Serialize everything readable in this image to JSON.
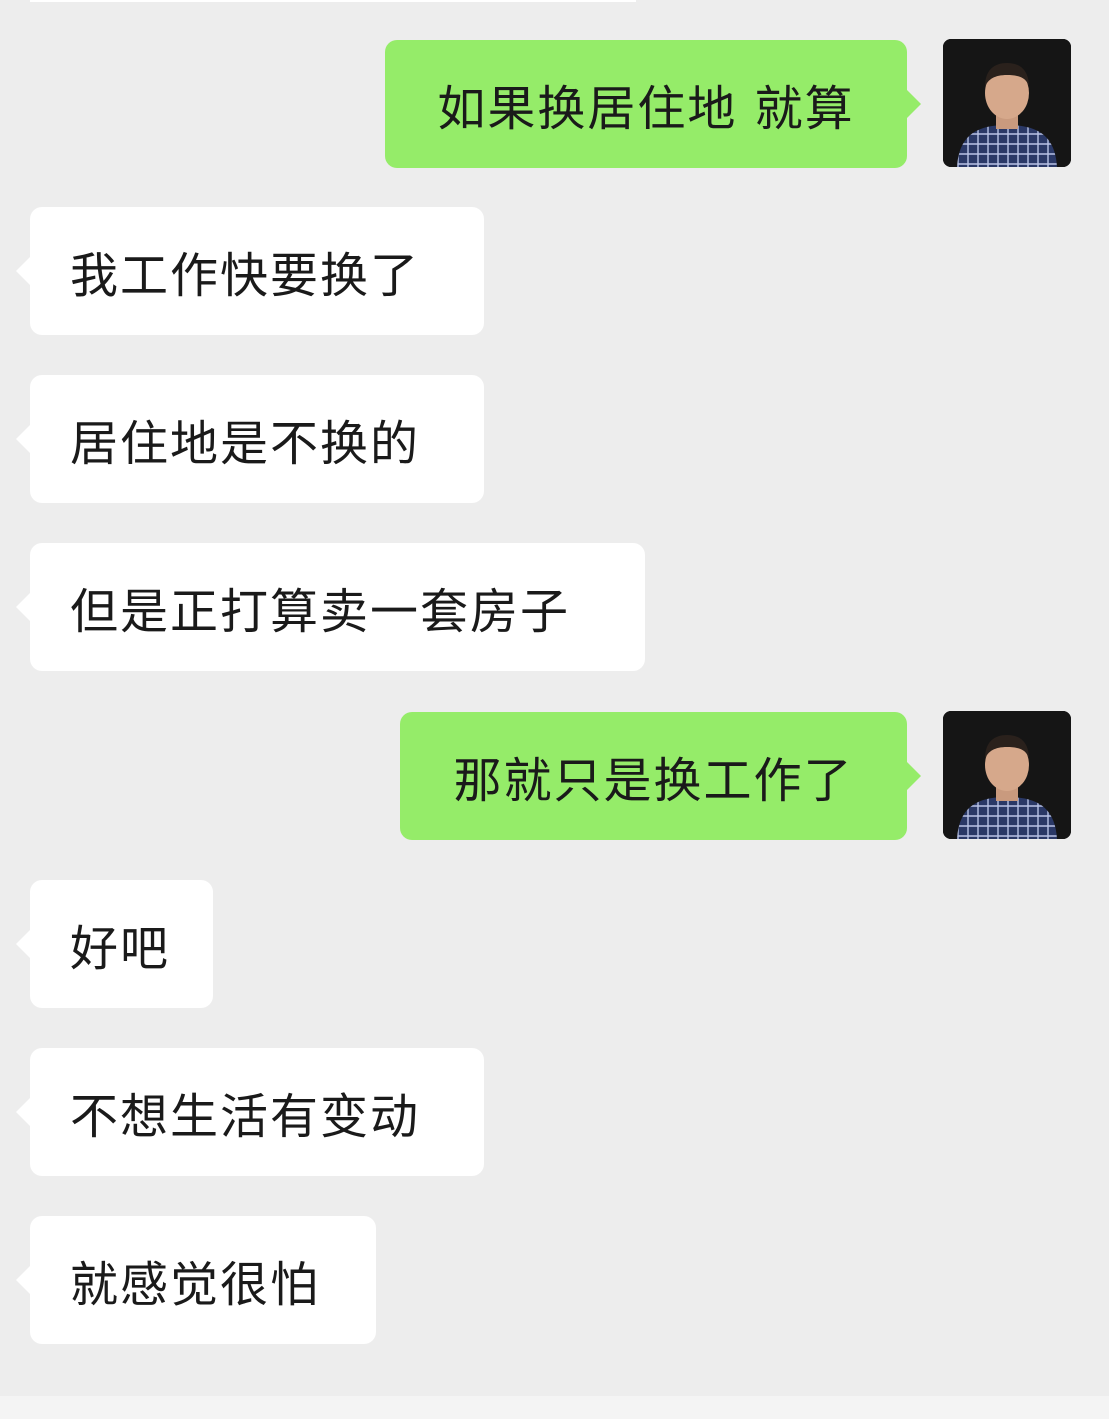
{
  "chat": {
    "messages": [
      {
        "side": "sent",
        "text": "如果换居住地 就算"
      },
      {
        "side": "received",
        "text": "我工作快要换了"
      },
      {
        "side": "received",
        "text": "居住地是不换的"
      },
      {
        "side": "received",
        "text": "但是正打算卖一套房子"
      },
      {
        "side": "sent",
        "text": "那就只是换工作了"
      },
      {
        "side": "received",
        "text": "好吧"
      },
      {
        "side": "received",
        "text": "不想生活有变动"
      },
      {
        "side": "received",
        "text": "就感觉很怕"
      }
    ]
  },
  "avatar": {
    "icon": "user-avatar-photo"
  },
  "colors": {
    "background": "#ededed",
    "sent_bubble": "#95ec69",
    "received_bubble": "#ffffff",
    "text": "#1a1a1a"
  }
}
